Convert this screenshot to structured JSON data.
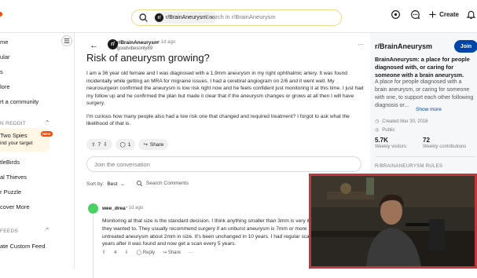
{
  "header": {
    "search_chip": "r/BrainAneurysm",
    "search_chip_avatar": "r/",
    "search_placeholder": "Search in r/BrainAneurysm",
    "create_label": "Create"
  },
  "left_nav": {
    "items": [
      "me",
      "ular",
      "s",
      "lore",
      "rt a community"
    ],
    "section1": "N REDDIT",
    "promo_title": "Two Spies",
    "promo_sub": "ind your target",
    "new_badge": "NEW",
    "games": [
      "tleBirds",
      "al Thieves",
      "r Puzzle",
      "cover More"
    ],
    "section2": "FEEDS",
    "feeds": [
      "ate Custom Feed"
    ]
  },
  "post": {
    "subreddit": "r/BrainAneurysm",
    "avatar": "r/",
    "time": "• 1d ago",
    "author": "goodvibesonly89",
    "title": "Risk of aneurysm growing?",
    "body_p1": "I am a 36 year old female and I was diagnosed with a 1.9mm aneurysm in my right ophthalmic artery. It was found incidentally while getting an MRA for migraine issues. I had a cerebral angiogram on 2/6 and it went well. My neurosurgeon confirmed the aneurysm is low risk right now and he feels confident just monitoring it at this time. I just had my follow up and he confirmed the plan but made it clear that if the aneurysm changes or grows at all then I will have surgery.",
    "body_p2": "I'm curious how many people also had a low risk one that changed and required treatment? I forgot to ask what the likelihood of that is.",
    "votes": "7",
    "comments": "1",
    "share_label": "Share"
  },
  "comments_area": {
    "join_placeholder": "Join the conversation",
    "sort_label": "Sort by:",
    "sort_value": "Best",
    "search_label": "Search Comments"
  },
  "comment": {
    "author": "wee_drea",
    "time": "• 1d ago",
    "body": "Monitoring at that size is the standard decision. I think anything smaller than 3mm is very if they wanted to. They usually recommend surgery if an unburst aneurysm is 7mm or more untreated aneurysm about 2mm in size. It's been unchanged in 10 years. I had regular sca years after it was found and now get a scan every 5 years.",
    "votes": "4",
    "reply_label": "Reply",
    "share_label": "Share"
  },
  "sidebar": {
    "name": "r/BrainAneurysm",
    "join_label": "Join",
    "headline": "BrainAneurysm: a place for people diagnosed with, or caring for someone with a brain aneurysm.",
    "description": "A place for people diagnosed with a brain aneurysm, or caring for someone with one, to support each other following diagnosis or...",
    "show_more": "Show more",
    "created": "Created Mar 30, 2016",
    "visibility": "Public",
    "visitors_value": "5.7K",
    "visitors_label": "Weekly visitors",
    "contrib_value": "72",
    "contrib_label": "Weekly contributions",
    "rules_header": "R/BRAINANEURYSM RULES"
  },
  "colors": {
    "accent": "#ff4500",
    "join": "#0045ac",
    "search_border": "#f2d987",
    "cam_border": "#c5373b"
  }
}
